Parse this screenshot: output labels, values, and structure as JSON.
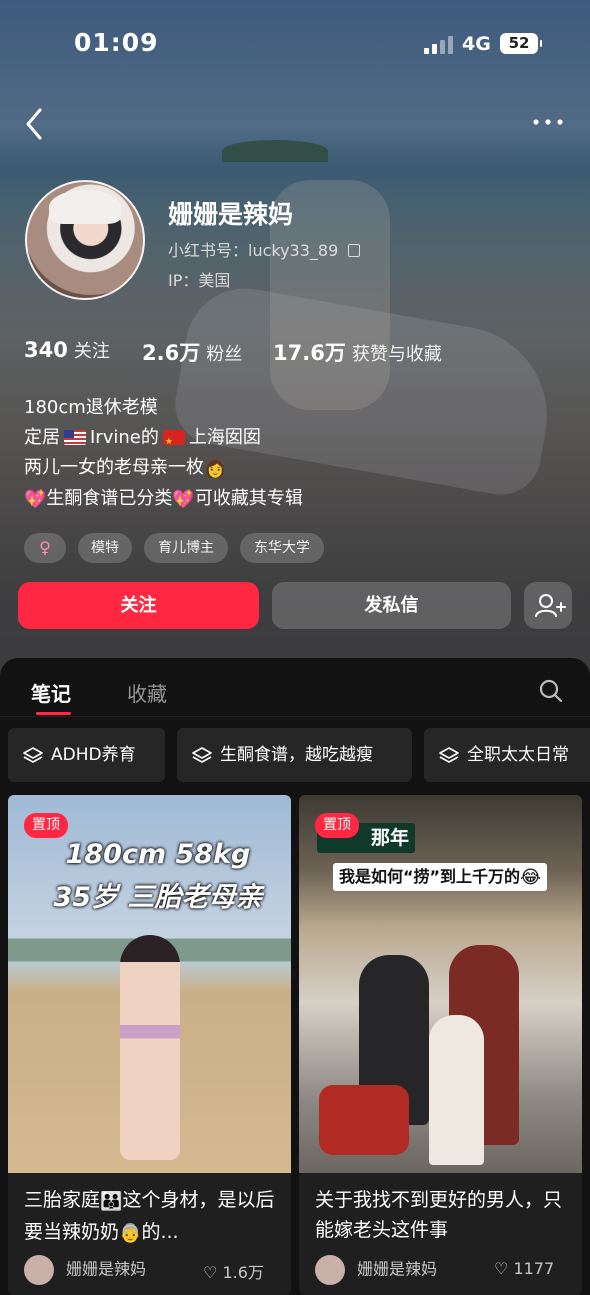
{
  "status_bar": {
    "time": "01:09",
    "network": "4G",
    "battery": "52"
  },
  "profile": {
    "name": "姗姗是辣妈",
    "red_id": "小红书号：lucky33_89",
    "ip": "IP：美国",
    "stats": [
      {
        "value": "340",
        "label": "关注"
      },
      {
        "value": "2.6万",
        "label": "粉丝"
      },
      {
        "value": "17.6万",
        "label": "获赞与收藏"
      }
    ],
    "bio": {
      "line1": "180cm退休老模",
      "line2_a": "定居",
      "line2_b": "Irvine的",
      "line2_c": "上海囡囡",
      "line3": "两儿一女的老母亲一枚",
      "line4_a": "生酮食谱已分类",
      "line4_b": "可收藏其专辑"
    },
    "gender_symbol": "♀",
    "tags": [
      "模特",
      "育儿博主",
      "东华大学"
    ]
  },
  "actions": {
    "follow": "关注",
    "message": "发私信"
  },
  "tabs": {
    "notes": "笔记",
    "collections": "收藏"
  },
  "collections": [
    "ADHD养育",
    "生酮食谱，越吃越瘦",
    "全职太太日常"
  ],
  "cards": [
    {
      "pin": "置顶",
      "headline1": "180cm  58kg",
      "headline2": "35岁  三胎老母亲",
      "title_a": "三胎家庭",
      "title_b": "这个身材，是以后要当辣奶奶",
      "title_c": "的...",
      "author": "姗姗是辣妈",
      "likes": "1.6万"
    },
    {
      "pin": "置顶",
      "sign_a": "那年",
      "sign_b": "我是如何“捞”到上千万的",
      "title": "关于我找不到更好的男人，只能嫁老头这件事",
      "author": "姗姗是辣妈",
      "likes": "1177"
    }
  ],
  "colors": {
    "accent": "#ff2742",
    "panel": "#121212",
    "card": "#1f1f1f"
  },
  "icons": [
    "back-icon",
    "more-icon",
    "copy-icon",
    "add-friend-icon",
    "search-icon",
    "layers-icon",
    "heart-icon"
  ]
}
